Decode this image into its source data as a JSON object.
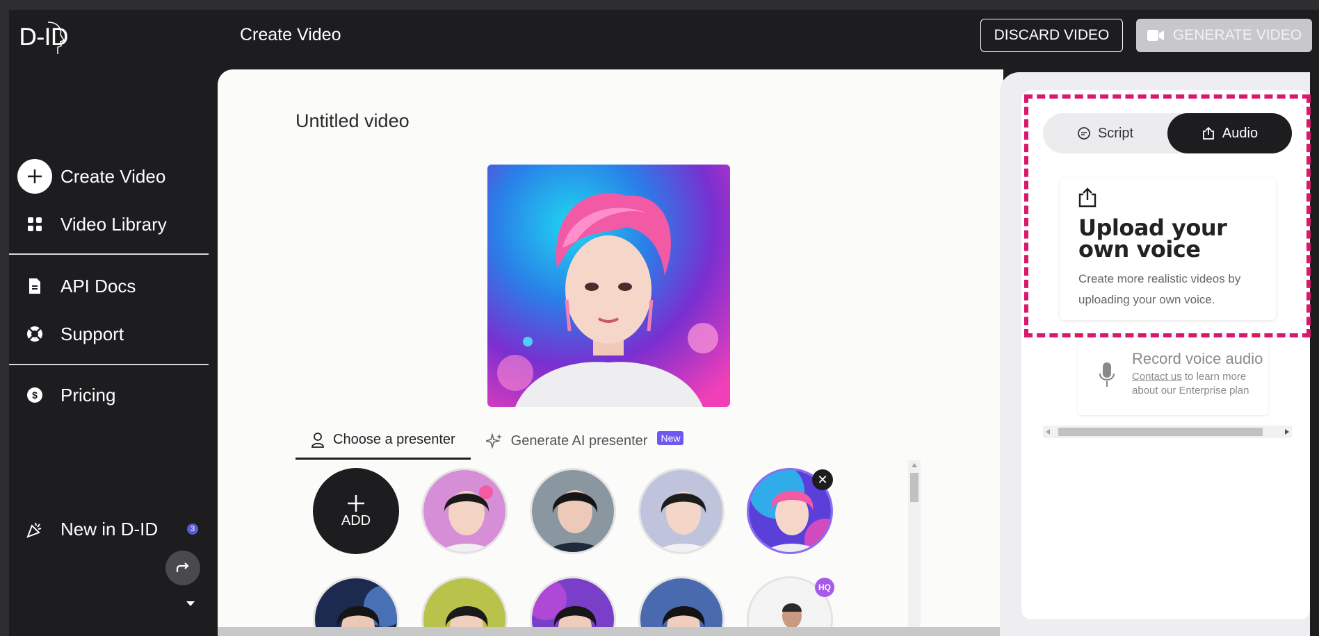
{
  "app": {
    "logo_text": "D-ID",
    "page_title": "Create Video"
  },
  "header": {
    "discard_label": "DISCARD VIDEO",
    "generate_label": "GENERATE VIDEO"
  },
  "sidebar": {
    "items": [
      {
        "label": "Create Video",
        "icon": "plus-icon"
      },
      {
        "label": "Video Library",
        "icon": "grid-icon"
      },
      {
        "label": "API Docs",
        "icon": "document-icon"
      },
      {
        "label": "Support",
        "icon": "lifebuoy-icon"
      },
      {
        "label": "Pricing",
        "icon": "dollar-icon"
      },
      {
        "label": "New in D-ID",
        "icon": "party-popper-icon",
        "badge": "3"
      }
    ]
  },
  "editor": {
    "video_title": "Untitled video",
    "tabs": [
      {
        "label": "Choose a presenter",
        "active": true
      },
      {
        "label": "Generate AI presenter",
        "badge": "New"
      }
    ],
    "add_label": "ADD",
    "remove_symbol": "✕",
    "hq_badge": "HQ"
  },
  "right_panel": {
    "tabs": [
      {
        "label": "Script",
        "active": false
      },
      {
        "label": "Audio",
        "active": true
      }
    ],
    "upload": {
      "title": "Upload your own voice",
      "description": "Create more realistic videos by uploading your own voice."
    },
    "record": {
      "title": "Record voice audio",
      "link_text": "Contact us",
      "description_rest": " to learn more about our Enterprise plan"
    }
  },
  "colors": {
    "highlight": "#d9176b",
    "accent": "#6d58f2",
    "dark": "#1d1d20"
  }
}
